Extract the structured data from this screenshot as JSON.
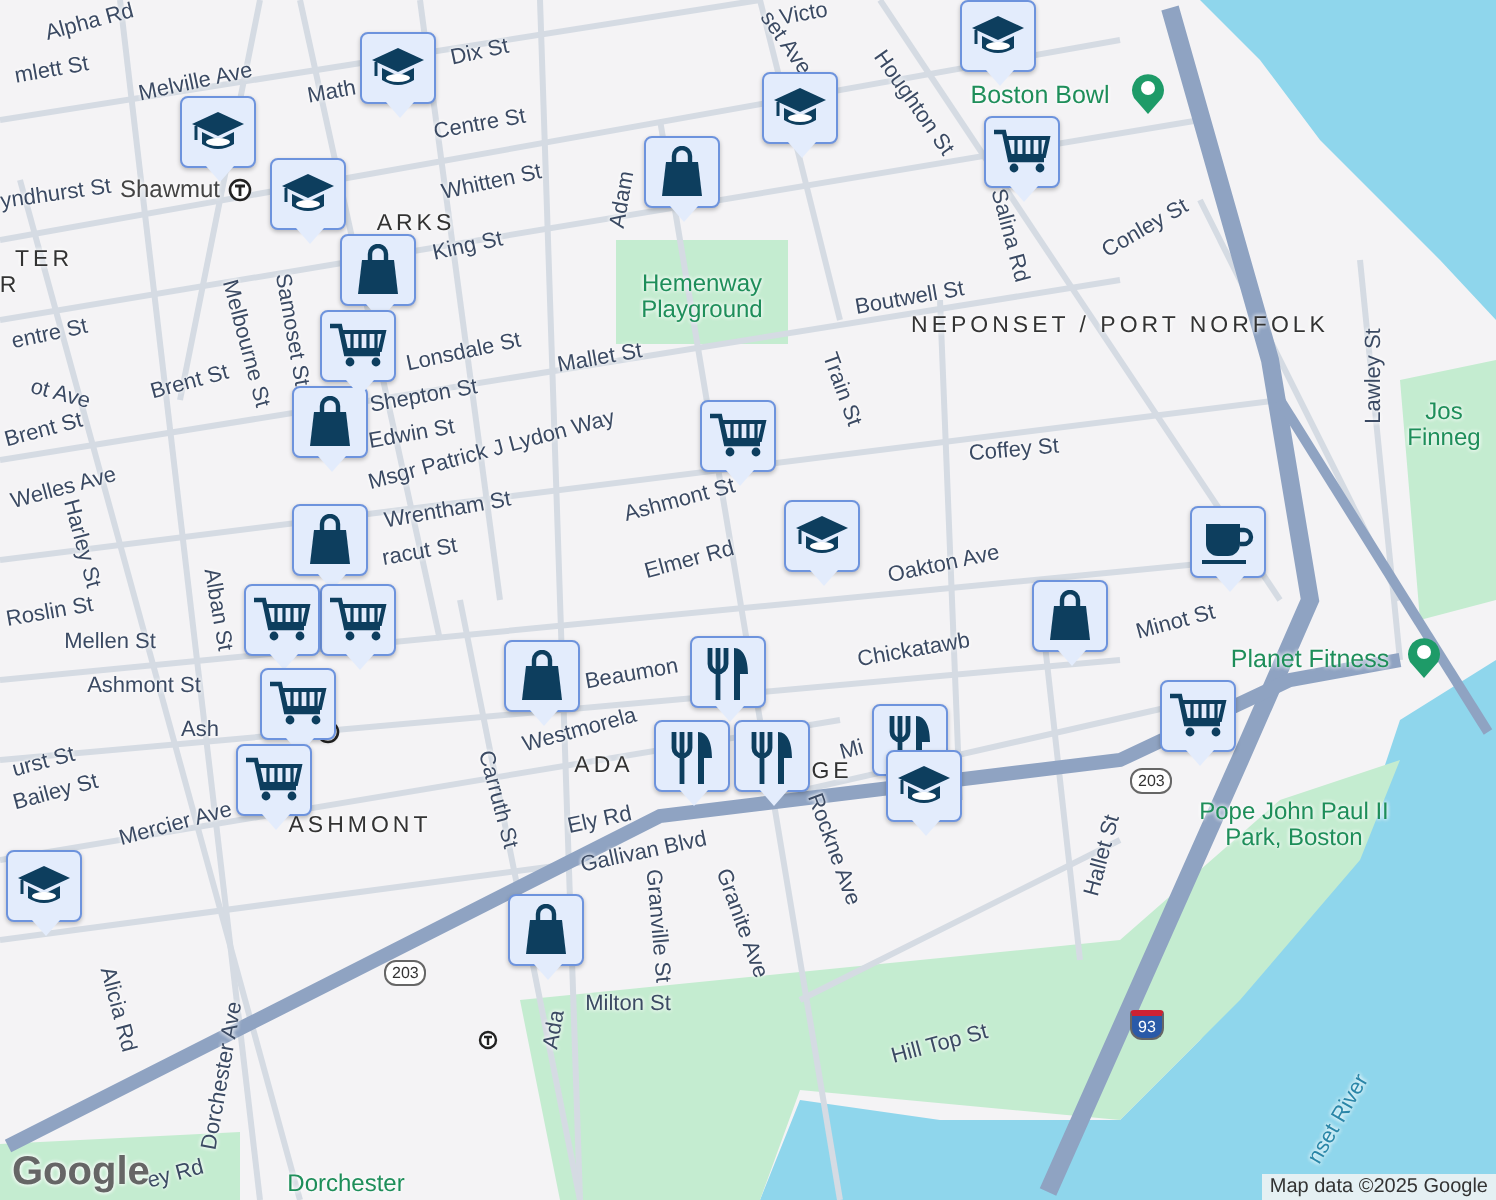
{
  "map": {
    "labels": [
      {
        "text": "Alpha Rd",
        "kind": "street"
      },
      {
        "text": "mlett St",
        "kind": "street"
      },
      {
        "text": "Melville Ave",
        "kind": "street"
      },
      {
        "text": "Math",
        "kind": "street"
      },
      {
        "text": "Dix St",
        "kind": "street"
      },
      {
        "text": "Centre St",
        "kind": "street"
      },
      {
        "text": "Shawmut",
        "kind": "station"
      },
      {
        "text": "yndhurst St",
        "kind": "street"
      },
      {
        "text": "ARKS",
        "kind": "area"
      },
      {
        "text": "Whitten St",
        "kind": "street"
      },
      {
        "text": "King St",
        "kind": "street"
      },
      {
        "text": "TER",
        "kind": "area"
      },
      {
        "text": "R",
        "kind": "area"
      },
      {
        "text": "Adam",
        "kind": "street"
      },
      {
        "text": "Hemenway Playground",
        "kind": "park"
      },
      {
        "text": "Boutwell St",
        "kind": "street"
      },
      {
        "text": "entre St",
        "kind": "street"
      },
      {
        "text": "Samoset St",
        "kind": "street"
      },
      {
        "text": "Melbourne St",
        "kind": "street"
      },
      {
        "text": "Lonsdale St",
        "kind": "street"
      },
      {
        "text": "Mallet St",
        "kind": "street"
      },
      {
        "text": "Brent St",
        "kind": "street"
      },
      {
        "text": "ot Ave",
        "kind": "street"
      },
      {
        "text": "Shepton St",
        "kind": "street"
      },
      {
        "text": "Train St",
        "kind": "street"
      },
      {
        "text": "Brent St",
        "kind": "street"
      },
      {
        "text": "Edwin St",
        "kind": "street"
      },
      {
        "text": "Msgr Patrick J Lydon Way",
        "kind": "street"
      },
      {
        "text": "Welles Ave",
        "kind": "street"
      },
      {
        "text": "Coffey St",
        "kind": "street"
      },
      {
        "text": "Wrentham St",
        "kind": "street"
      },
      {
        "text": "Ashmont St",
        "kind": "street"
      },
      {
        "text": "Harley St",
        "kind": "street"
      },
      {
        "text": "racut St",
        "kind": "street"
      },
      {
        "text": "Elmer Rd",
        "kind": "street"
      },
      {
        "text": "Oakton Ave",
        "kind": "street"
      },
      {
        "text": "set Ave",
        "kind": "street"
      },
      {
        "text": "Victo",
        "kind": "street"
      },
      {
        "text": "Houghton St",
        "kind": "street"
      },
      {
        "text": "Boston Bowl",
        "kind": "poi"
      },
      {
        "text": "Salina Rd",
        "kind": "street"
      },
      {
        "text": "Conley St",
        "kind": "street"
      },
      {
        "text": "NEPONSET / PORT NORFOLK",
        "kind": "area"
      },
      {
        "text": "Lawley St",
        "kind": "street"
      },
      {
        "text": "Jos Finneg",
        "kind": "park"
      },
      {
        "text": "Roslin St",
        "kind": "street"
      },
      {
        "text": "Alban St",
        "kind": "street"
      },
      {
        "text": "Mellen St",
        "kind": "street"
      },
      {
        "text": "Chickatawb",
        "kind": "street"
      },
      {
        "text": "Minot St",
        "kind": "street"
      },
      {
        "text": "Planet Fitness",
        "kind": "poi"
      },
      {
        "text": "Ashmont St",
        "kind": "street"
      },
      {
        "text": "Beaumon",
        "kind": "street"
      },
      {
        "text": "Ash",
        "kind": "street"
      },
      {
        "text": "Westmorela",
        "kind": "street"
      },
      {
        "text": "urst St",
        "kind": "street"
      },
      {
        "text": "ADA",
        "kind": "area"
      },
      {
        "text": "GE",
        "kind": "area"
      },
      {
        "text": "Mi",
        "kind": "street"
      },
      {
        "text": "Bailey St",
        "kind": "street"
      },
      {
        "text": "Carruth St",
        "kind": "street"
      },
      {
        "text": "Mercier Ave",
        "kind": "street"
      },
      {
        "text": "ASHMONT",
        "kind": "area"
      },
      {
        "text": "Ely Rd",
        "kind": "street"
      },
      {
        "text": "Gallivan Blvd",
        "kind": "street"
      },
      {
        "text": "Pope John Paul II Park, Boston",
        "kind": "park"
      },
      {
        "text": "Rockne Ave",
        "kind": "street"
      },
      {
        "text": "Hallet St",
        "kind": "street"
      },
      {
        "text": "Granville St",
        "kind": "street"
      },
      {
        "text": "Granite Ave",
        "kind": "street"
      },
      {
        "text": "Alicia Rd",
        "kind": "street"
      },
      {
        "text": "Milton St",
        "kind": "street"
      },
      {
        "text": "Ada",
        "kind": "street"
      },
      {
        "text": "Hill Top St",
        "kind": "street"
      },
      {
        "text": "Dorchester Ave",
        "kind": "street"
      },
      {
        "text": "nset River",
        "kind": "water"
      },
      {
        "text": "Dorchester",
        "kind": "park"
      },
      {
        "text": "ey Rd",
        "kind": "street"
      }
    ],
    "shields": [
      {
        "text": "203",
        "kind": "state"
      },
      {
        "text": "203",
        "kind": "state"
      },
      {
        "text": "93",
        "kind": "interstate"
      }
    ],
    "pins": [
      {
        "kind": "school"
      },
      {
        "kind": "school"
      },
      {
        "kind": "school"
      },
      {
        "kind": "school"
      },
      {
        "kind": "school"
      },
      {
        "kind": "school"
      },
      {
        "kind": "school"
      },
      {
        "kind": "shopping"
      },
      {
        "kind": "shopping"
      },
      {
        "kind": "shopping"
      },
      {
        "kind": "shopping"
      },
      {
        "kind": "shopping"
      },
      {
        "kind": "shopping"
      },
      {
        "kind": "shopping"
      },
      {
        "kind": "grocery"
      },
      {
        "kind": "grocery"
      },
      {
        "kind": "grocery"
      },
      {
        "kind": "grocery"
      },
      {
        "kind": "grocery"
      },
      {
        "kind": "grocery"
      },
      {
        "kind": "grocery"
      },
      {
        "kind": "grocery"
      },
      {
        "kind": "cafe"
      },
      {
        "kind": "restaurant"
      },
      {
        "kind": "restaurant"
      },
      {
        "kind": "restaurant"
      },
      {
        "kind": "restaurant"
      },
      {
        "kind": "school"
      }
    ],
    "logo": "Google",
    "attribution": "Map data ©2025 Google"
  }
}
